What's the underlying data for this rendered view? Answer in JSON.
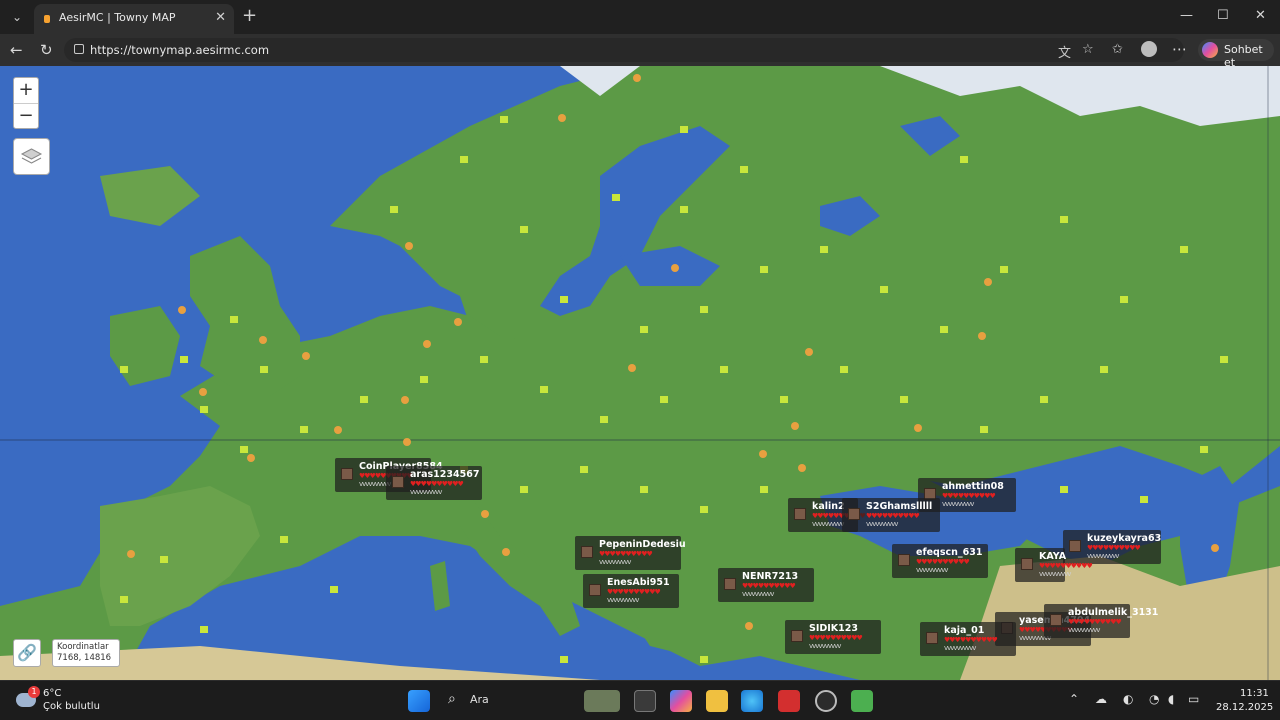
{
  "browser": {
    "tab_title": "AesirMC | Towny MAP",
    "url": "https://townymap.aesirmc.com",
    "copilot_label": "Sohbet et",
    "icons": [
      "tab-menu-icon",
      "close-icon",
      "plus-icon",
      "back-icon",
      "reload-icon",
      "lock-icon",
      "translate-icon",
      "star-icon",
      "favorites-icon",
      "profile-icon",
      "more-icon"
    ]
  },
  "map": {
    "zoom_in": "+",
    "zoom_out": "−",
    "link_icon": "🔗",
    "coords_title": "Koordinatlar",
    "coords_value": "7168, 14816",
    "players": [
      {
        "name": "CoinPlayer8584"
      },
      {
        "name": "aras1234567"
      },
      {
        "name": "ahmettin08"
      },
      {
        "name": "kalin2"
      },
      {
        "name": "S2Ghamslllll"
      },
      {
        "name": "PepeninDedesiu"
      },
      {
        "name": "efeqscn_631"
      },
      {
        "name": "kuzeykayra63"
      },
      {
        "name": "KAYA"
      },
      {
        "name": "NENR7213"
      },
      {
        "name": "EnesAbi951"
      },
      {
        "name": "SIDIK123"
      },
      {
        "name": "kaja_01"
      },
      {
        "name": "yasemin4704"
      },
      {
        "name": "abdulmelik_3131"
      }
    ],
    "hp_glyphs": "♥♥♥♥♥♥♥♥♥♥",
    "armor_glyphs": "vvvvvvvvvv",
    "colors": {
      "ocean": "#3c6dc4",
      "land": "#5e9a44",
      "desert": "#d8c890"
    }
  },
  "taskbar": {
    "weather_badge": "1",
    "weather_temp": "6°C",
    "weather_desc": "Çok bulutlu",
    "search_label": "Ara",
    "time": "11:31",
    "date": "28.12.2025"
  }
}
